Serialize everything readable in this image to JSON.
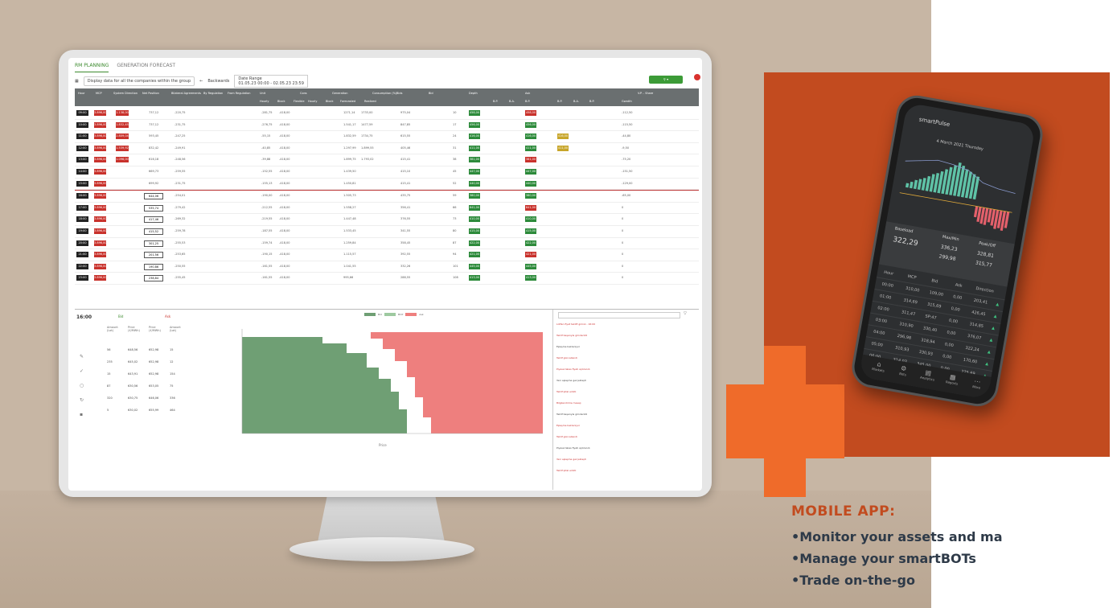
{
  "app": {
    "tabs": [
      "RM PLANNING",
      "GENERATION FORECAST"
    ],
    "filter_label": "Display data for all the companies within the group",
    "back_label": "Backwards",
    "date_range_label": "Date Range",
    "date_range_value": "01.05.23 00:00 - 02.05.23 23:59"
  },
  "grid": {
    "headers": [
      "Hour",
      "MCP",
      "System Direction",
      "Net Position",
      "Bilateral Agreements",
      "By Regulation",
      "From Regulation",
      "Unit",
      "Cons",
      "Generation",
      "Consumption (%)",
      "Bids",
      "Bid",
      "Depth",
      "Ask",
      "V.P. - Share"
    ],
    "subheaders": [
      "Hourly",
      "Block",
      "Flexible",
      "Hourly",
      "Block",
      "Forecasted",
      "Realized",
      "B.P.",
      "B.A.",
      "B.P.",
      "B.P.",
      "B.A.",
      "B.P.",
      "Gwatth"
    ],
    "rows": [
      {
        "hour": "09:00",
        "mcp": "3.896,00",
        "sd": "1.138,00",
        "net": "737,12",
        "bil": "-220,75",
        "unit": "-281,75",
        "block": "-418,00",
        "gen": "1271,14",
        "cons": "1733,00",
        "pct": "975,04",
        "bid": "458,00",
        "ask": "-112,50"
      },
      {
        "hour": "10:00",
        "mcp": "3.896,00",
        "sd": "1.832,45",
        "net": "737,12",
        "bil": "-231,75",
        "unit": "-276,75",
        "block": "-418,00",
        "gen": "1.541,17",
        "cons": "1477,59",
        "pct": "847,85",
        "bid": "456,00",
        "ask": "-115,50"
      },
      {
        "hour": "11:00",
        "mcp": "3.896,00",
        "sd": "2.809,04",
        "net": "593,45",
        "bil": "-247,25",
        "unit": "-55,15",
        "block": "-418,00",
        "gen": "1.832,59",
        "cons": "1734,75",
        "pct": "615,55",
        "bid": "416,00",
        "ask": "-44,80"
      },
      {
        "hour": "12:00",
        "mcp": "3.896,00",
        "sd": "1.539,92",
        "net": "832,42",
        "bil": "-249,91",
        "unit": "-40,85",
        "block": "-418,00",
        "gen": "1.297,99",
        "cons": "1.899,55",
        "pct": "405,46",
        "bid": "411,00",
        "ask": "-9,50"
      },
      {
        "hour": "13:00",
        "mcp": "3.896,00",
        "sd": "1.096,00",
        "net": "616,18",
        "bil": "-248,56",
        "unit": "-39,88",
        "block": "-418,00",
        "gen": "1.899,75",
        "cons": "1.793,02",
        "pct": "415,41",
        "bid": "381,00",
        "ask": "-75,20"
      },
      {
        "hour": "14:00",
        "mcp": "3.896,00",
        "sd": "",
        "net": "669,73",
        "bil": "-259,55",
        "unit": "-152,55",
        "block": "-418,00",
        "gen": "1.439,50",
        "cons": "",
        "pct": "415,10",
        "bid": "447,00",
        "ask": "-151,50"
      },
      {
        "hour": "15:00",
        "mcp": "3.896,00",
        "sd": "",
        "net": "699,92",
        "bil": "-231,75",
        "unit": "-155,13",
        "block": "-418,00",
        "gen": "1.450,81",
        "cons": "",
        "pct": "415,41",
        "bid": "440,00",
        "ask": "-129,00"
      },
      {
        "hour": "16:00",
        "mcp": "3.896,00",
        "sd": "",
        "net": "644,06",
        "bil": "-254,01",
        "unit": "-190,00",
        "block": "-418,00",
        "gen": "1.505,73",
        "cons": "",
        "pct": "435,75",
        "bid": "380,00",
        "ask": "-65,00"
      },
      {
        "hour": "17:00",
        "mcp": "3.896,00",
        "sd": "",
        "net": "535,74",
        "bil": "-279,42",
        "unit": "-212,55",
        "block": "-418,00",
        "gen": "1.558,27",
        "cons": "",
        "pct": "356,41",
        "bid": "841,00",
        "ask": "0"
      },
      {
        "hour": "18:00",
        "mcp": "3.896,00",
        "sd": "",
        "net": "417,46",
        "bil": "-269,32",
        "unit": "-219,55",
        "block": "-418,00",
        "gen": "1.447,48",
        "cons": "",
        "pct": "376,55",
        "bid": "410,00",
        "ask": "0"
      },
      {
        "hour": "19:00",
        "mcp": "3.896,00",
        "sd": "",
        "net": "415,52",
        "bil": "-259,78",
        "unit": "-187,55",
        "block": "-418,00",
        "gen": "1.533,45",
        "cons": "",
        "pct": "341,55",
        "bid": "415,00",
        "ask": "0"
      },
      {
        "hour": "20:00",
        "mcp": "3.896,00",
        "sd": "",
        "net": "301,25",
        "bil": "-255,53",
        "unit": "-159,74",
        "block": "-418,00",
        "gen": "1.259,84",
        "cons": "",
        "pct": "358,45",
        "bid": "422,00",
        "ask": "0"
      },
      {
        "hour": "21:00",
        "mcp": "3.896,00",
        "sd": "",
        "net": "201,56",
        "bil": "-253,65",
        "unit": "-190,15",
        "block": "-418,00",
        "gen": "1.115,57",
        "cons": "",
        "pct": "392,55",
        "bid": "421,00",
        "ask": "0"
      },
      {
        "hour": "22:00",
        "mcp": "3.896,00",
        "sd": "",
        "net": "190,86",
        "bil": "-250,55",
        "unit": "-161,55",
        "block": "-418,00",
        "gen": "1.041,55",
        "cons": "",
        "pct": "332,26",
        "bid": "445,00",
        "ask": "0"
      },
      {
        "hour": "23:00",
        "mcp": "3.896,00",
        "sd": "",
        "net": "238,84",
        "bil": "-255,45",
        "unit": "-161,55",
        "block": "-418,00",
        "gen": "995,66",
        "cons": "",
        "pct": "288,55",
        "bid": "413,00",
        "ask": "0"
      }
    ]
  },
  "orderbook": {
    "hour": "16:00",
    "bid_label": "Bid",
    "ask_label": "Ask",
    "cols": [
      "Amount (Lot)",
      "Price (£/MWh)",
      "Price (£/MWh)",
      "Amount (Lot)"
    ],
    "rows": [
      [
        "56",
        "648,56",
        "652,98",
        "15"
      ],
      [
        "235",
        "645,02",
        "652,98",
        "12"
      ],
      [
        "15",
        "643,91",
        "652,98",
        "154"
      ],
      [
        "87",
        "630,56",
        "653,05",
        "75"
      ],
      [
        "320",
        "630,75",
        "646,06",
        "336"
      ],
      [
        "5",
        "630,02",
        "655,99",
        "464"
      ]
    ],
    "chart_legend": [
      "Bid",
      "MCP",
      "Ask"
    ],
    "chart_xlabel": "Price",
    "colors": {
      "bid": "#6f9f74",
      "ask": "#ee7f7e",
      "mcp": "#4b8d53"
    }
  },
  "log": {
    "lines": [
      "Lütfen fiyat teklifi giriniz - 16:00",
      "Teklif başarıyla gönderildi",
      "Eşleşme bekleniyor",
      "Teklif güncellendi",
      "Piyasa takas fiyatı açıklandı",
      "Yeni eşleşme gerçekleşti",
      "Teklif iptal edildi",
      "Bilgilendirme mesajı",
      "Teklif başarıyla gönderildi",
      "Eşleşme bekleniyor",
      "Teklif güncellendi",
      "Piyasa takas fiyatı açıklandı",
      "Yeni eşleşme gerçekleşti",
      "Teklif iptal edildi"
    ]
  },
  "mobile": {
    "app_name": "smartPulse",
    "date": "4 March 2021 Thursday",
    "summary": {
      "baseload_label": "Baseload",
      "baseload_value": "322,29",
      "maxmin_label": "Max/Min",
      "max_value": "336,23",
      "min_value": "299,98",
      "peak_label": "Peak/Off",
      "peak_value": "328,81",
      "off_value": "315,77"
    },
    "table_headers": [
      "Hour",
      "MCP",
      "Bid",
      "Ask",
      "Direction"
    ],
    "table_rows": [
      [
        "00:00",
        "310,00",
        "109,00",
        "0,00",
        "203,41"
      ],
      [
        "01:00",
        "314,69",
        "315,69",
        "0,00",
        "426,45"
      ],
      [
        "02:00",
        "311,47",
        "SP:47",
        "0,00",
        "314,85"
      ],
      [
        "03:00",
        "310,90",
        "330,40",
        "0,00",
        "376,07"
      ],
      [
        "04:00",
        "296,98",
        "318,94",
        "0,00",
        "322,24"
      ],
      [
        "05:00",
        "310,93",
        "330,93",
        "0,00",
        "170,60"
      ],
      [
        "06:00",
        "314,03",
        "345,00",
        "0,00",
        "225,69"
      ]
    ],
    "nav": [
      "Markets",
      "Bots",
      "Analytics",
      "Reports",
      "More"
    ],
    "bar_heights": [
      0.12,
      0.18,
      0.25,
      0.3,
      0.35,
      0.42,
      0.5,
      0.55,
      0.62,
      0.7,
      0.78,
      0.85,
      0.95,
      0.88,
      0.8,
      0.75,
      0.7,
      0.65
    ],
    "neg_heights": [
      0.4,
      0.55,
      0.6,
      0.62,
      0.5,
      0.6,
      0.7,
      0.65,
      0.72,
      0.6
    ],
    "colors": {
      "pos": "#5fc3a7",
      "neg": "#e4606b"
    }
  },
  "marketing": {
    "title": "MOBILE APP:",
    "bullets": [
      "•Monitor your assets and ma",
      "•Manage your smartBOTs",
      "•Trade on-the-go"
    ],
    "colors": {
      "title": "#c24b1f",
      "text": "#2e3a48",
      "accent": "#ef6b2a"
    }
  }
}
